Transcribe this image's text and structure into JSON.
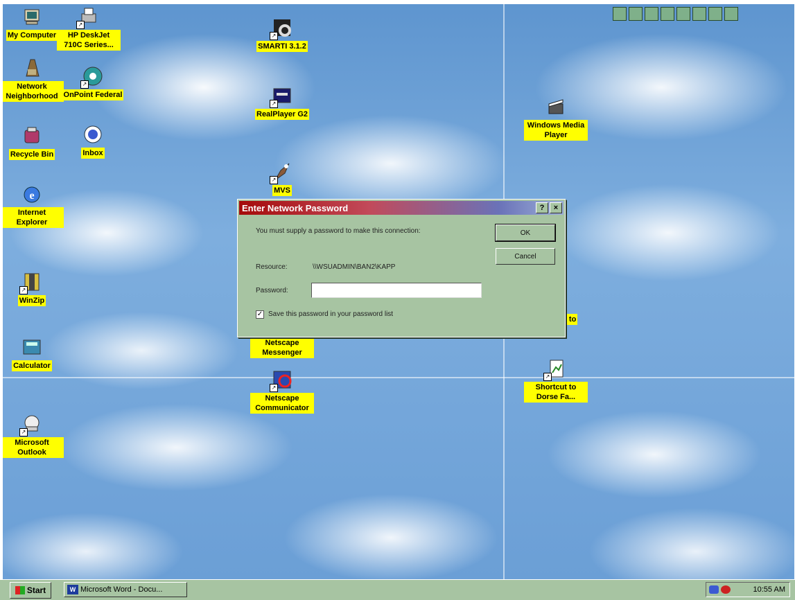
{
  "desktop_icons": [
    {
      "label": "My Computer",
      "icon": "computer-icon"
    },
    {
      "label": "HP DeskJet 710C Series...",
      "icon": "printer-icon"
    },
    {
      "label": "SMARTI 3.1.2",
      "icon": "smarti-icon"
    },
    {
      "label": "Network Neighborhood",
      "icon": "network-icon"
    },
    {
      "label": "OnPoint Federal",
      "icon": "onpoint-icon"
    },
    {
      "label": "RealPlayer G2",
      "icon": "realplayer-icon"
    },
    {
      "label": "Recycle Bin",
      "icon": "recycle-bin-icon"
    },
    {
      "label": "Inbox",
      "icon": "inbox-icon"
    },
    {
      "label": "MVS",
      "icon": "mvs-icon"
    },
    {
      "label": "Internet Explorer",
      "icon": "internet-explorer-icon"
    },
    {
      "label": "WinZip",
      "icon": "winzip-icon"
    },
    {
      "label": "Calculator",
      "icon": "calculator-icon"
    },
    {
      "label": "Netscape Messenger",
      "icon": "netscape-messenger-icon"
    },
    {
      "label": "Netscape Communicator",
      "icon": "netscape-communicator-icon"
    },
    {
      "label": "Microsoft Outlook",
      "icon": "outlook-icon"
    },
    {
      "label": "Windows Media Player",
      "icon": "media-player-icon"
    },
    {
      "label": "Shortcut to",
      "icon": "shortcut-icon"
    },
    {
      "label": "Shortcut to Dorse Fa...",
      "icon": "document-shortcut-icon"
    }
  ],
  "dialog": {
    "title": "Enter Network Password",
    "help_button": "?",
    "close_button": "×",
    "message": "You must supply a password to make this connection:",
    "resource_label": "Resource:",
    "resource_value": "\\\\WSUADMIN\\BAN2\\KAPP",
    "password_label": "Password:",
    "password_value": "",
    "save_checked": true,
    "save_checkbox_mark": "✓",
    "save_label": "Save this password in your password list",
    "ok_label": "OK",
    "cancel_label": "Cancel"
  },
  "taskbar": {
    "start_label": "Start",
    "task_word_label": "Microsoft Word - Docu...",
    "task_word_icon": "W",
    "clock": "10:55 AM"
  },
  "colors": {
    "icon_label_bg": "#ffff00",
    "dialog_bg": "#a7c4a2",
    "title_gradient_start": "#a50a0a",
    "title_gradient_end": "#9cb0d8"
  }
}
